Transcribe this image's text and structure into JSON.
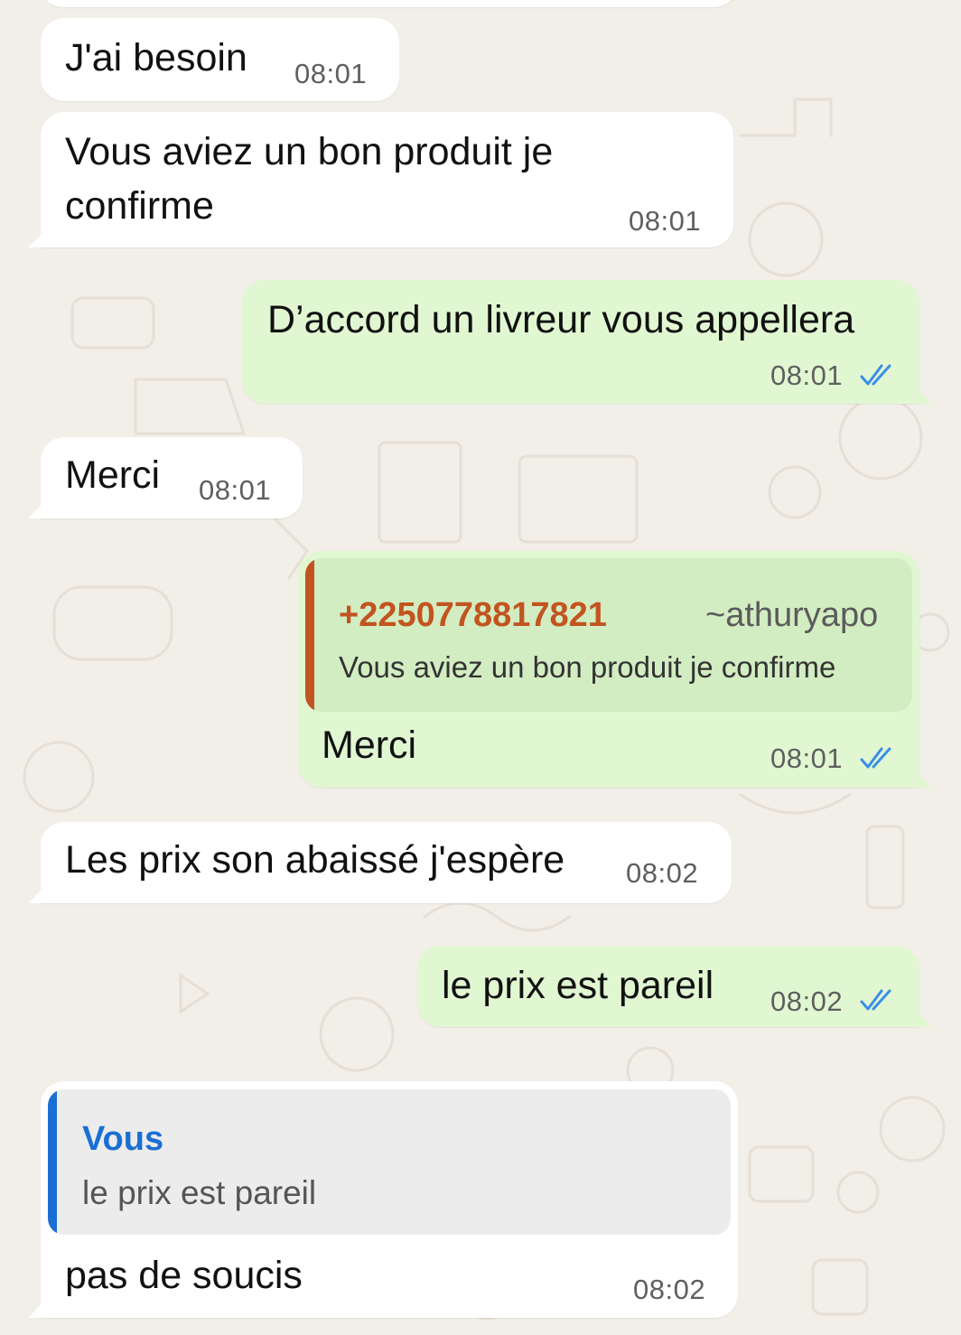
{
  "messages": [
    {
      "text": "J'ai besoin",
      "time": "08:01"
    },
    {
      "text": "Vous aviez un bon produit je confirme",
      "line1": "Vous aviez un bon produit je",
      "line2": "confirme",
      "time": "08:01"
    },
    {
      "text": "D’accord un livreur vous appellera",
      "time": "08:01"
    },
    {
      "text": "Merci",
      "time": "08:01"
    },
    {
      "quote": {
        "sender": "+2250778817821",
        "author": "~athuryapo",
        "text": "Vous aviez un bon produit je confirme"
      },
      "text": "Merci",
      "time": "08:01"
    },
    {
      "text": "Les prix son abaissé j'espère",
      "time": "08:02"
    },
    {
      "text": "le prix est pareil",
      "time": "08:02"
    },
    {
      "quote": {
        "sender": "Vous",
        "text": "le prix est pareil"
      },
      "text": "pas de soucis",
      "time": "08:02"
    }
  ],
  "icons": {
    "read_receipt": "double-check-icon"
  },
  "colors": {
    "incoming_bubble": "#ffffff",
    "outgoing_bubble": "#e1f7d2",
    "read_tick": "#3b8ee8",
    "quote_sender_other": "#c2541f",
    "quote_sender_self": "#1b6fd3",
    "quote_bar_other": "#c2541f",
    "quote_bar_self": "#1b6fd3"
  }
}
